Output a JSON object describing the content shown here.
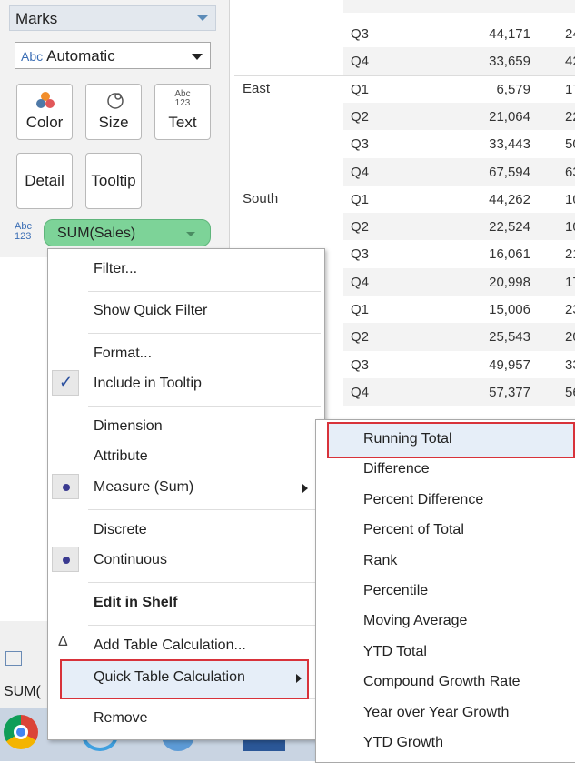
{
  "marks": {
    "header": "Marks",
    "mark_type": {
      "icon": "Abc",
      "value": "Automatic"
    },
    "buttons": {
      "color": "Color",
      "size": "Size",
      "text": "Text",
      "detail": "Detail",
      "tooltip": "Tooltip"
    },
    "text_icon_top": "Abc",
    "text_icon_bottom": "123",
    "pill": {
      "icon_top": "Abc",
      "icon_bottom": "123",
      "label": "SUM(Sales)"
    }
  },
  "table": {
    "rows": [
      {
        "region": "",
        "quarter": "Q3",
        "value": "44,171",
        "extra": "24"
      },
      {
        "region": "",
        "quarter": "Q4",
        "value": "33,659",
        "extra": "42"
      },
      {
        "region": "East",
        "quarter": "Q1",
        "value": "6,579",
        "extra": "17"
      },
      {
        "region": "",
        "quarter": "Q2",
        "value": "21,064",
        "extra": "22"
      },
      {
        "region": "",
        "quarter": "Q3",
        "value": "33,443",
        "extra": "50"
      },
      {
        "region": "",
        "quarter": "Q4",
        "value": "67,594",
        "extra": "63"
      },
      {
        "region": "South",
        "quarter": "Q1",
        "value": "44,262",
        "extra": "10"
      },
      {
        "region": "",
        "quarter": "Q2",
        "value": "22,524",
        "extra": "10"
      },
      {
        "region": "",
        "quarter": "Q3",
        "value": "16,061",
        "extra": "21"
      },
      {
        "region": "",
        "quarter": "Q4",
        "value": "20,998",
        "extra": "17"
      },
      {
        "region": "",
        "quarter": "Q1",
        "value": "15,006",
        "extra": "23"
      },
      {
        "region": "",
        "quarter": "Q2",
        "value": "25,543",
        "extra": "20"
      },
      {
        "region": "",
        "quarter": "Q3",
        "value": "49,957",
        "extra": "33"
      },
      {
        "region": "",
        "quarter": "Q4",
        "value": "57,377",
        "extra": "56"
      }
    ]
  },
  "context_menu": {
    "filter": "Filter...",
    "show_quick_filter": "Show Quick Filter",
    "format": "Format...",
    "include_in_tooltip": "Include in Tooltip",
    "dimension": "Dimension",
    "attribute": "Attribute",
    "measure": "Measure (Sum)",
    "discrete": "Discrete",
    "continuous": "Continuous",
    "edit_in_shelf": "Edit in Shelf",
    "add_table_calc": "Add Table Calculation...",
    "quick_table_calc": "Quick Table Calculation",
    "remove": "Remove",
    "check_glyph": "✓",
    "delta_glyph": "Δ"
  },
  "submenu": {
    "items": [
      "Running Total",
      "Difference",
      "Percent Difference",
      "Percent of Total",
      "Rank",
      "Percentile",
      "Moving Average",
      "YTD Total",
      "Compound Growth Rate",
      "Year over Year Growth",
      "YTD Growth"
    ]
  },
  "bottom_left": {
    "sum_stub": "SUM("
  },
  "colors": {
    "pill": "#7dd398",
    "highlight_border": "#d8323a",
    "accent_blue": "#3b6eb5"
  }
}
